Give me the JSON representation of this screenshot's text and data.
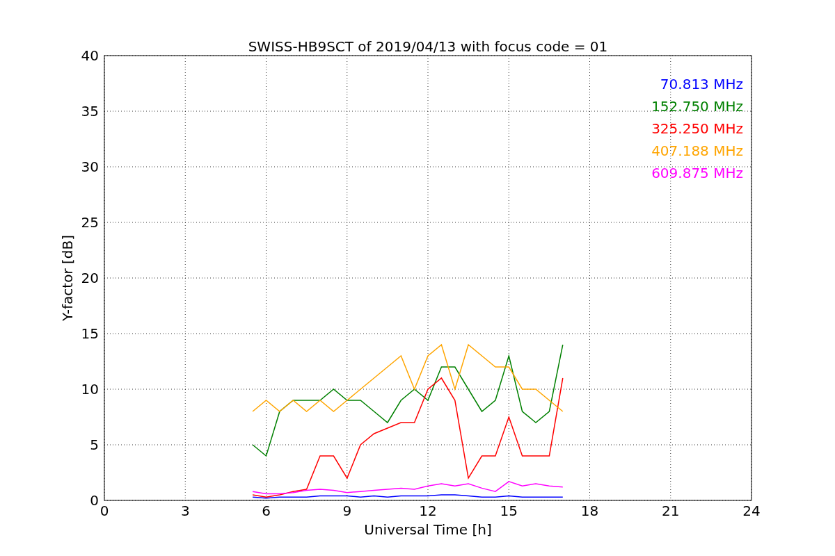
{
  "chart_data": {
    "type": "line",
    "title": "SWISS-HB9SCT of 2019/04/13 with focus code = 01",
    "xlabel": "Universal Time [h]",
    "ylabel": "Y-factor [dB]",
    "x": [
      5.5,
      6,
      6.5,
      7,
      7.5,
      8,
      8.5,
      9,
      9.5,
      10,
      10.5,
      11,
      11.5,
      12,
      12.5,
      13,
      13.5,
      14,
      14.5,
      15,
      15.5,
      16,
      16.5,
      17
    ],
    "series": [
      {
        "name": "70.813 MHz",
        "color": "#0000ff",
        "values": [
          0.3,
          0.2,
          0.3,
          0.3,
          0.3,
          0.4,
          0.4,
          0.4,
          0.3,
          0.4,
          0.3,
          0.4,
          0.4,
          0.4,
          0.5,
          0.5,
          0.4,
          0.3,
          0.3,
          0.4,
          0.3,
          0.3,
          0.3,
          0.3
        ]
      },
      {
        "name": "152.750 MHz",
        "color": "#008000",
        "values": [
          5,
          4,
          8,
          9,
          9,
          9,
          10,
          9,
          9,
          8,
          7,
          9,
          10,
          9,
          12,
          12,
          10,
          8,
          9,
          13,
          8,
          7,
          8,
          14
        ]
      },
      {
        "name": "325.250 MHz",
        "color": "#ff0000",
        "values": [
          0.5,
          0.3,
          0.5,
          0.8,
          1,
          4,
          4,
          2,
          5,
          6,
          6.5,
          7,
          7,
          10,
          11,
          9,
          2,
          4,
          4,
          7.5,
          4,
          4,
          4,
          11
        ]
      },
      {
        "name": "407.188 MHz",
        "color": "#ffa500",
        "values": [
          8,
          9,
          8,
          9,
          8,
          9,
          8,
          9,
          10,
          11,
          12,
          13,
          10,
          13,
          14,
          10,
          14,
          13,
          12,
          12,
          10,
          10,
          9,
          8
        ]
      },
      {
        "name": "609.875 MHz",
        "color": "#ff00ff",
        "values": [
          0.8,
          0.6,
          0.6,
          0.7,
          0.9,
          1,
          0.9,
          0.7,
          0.8,
          0.9,
          1,
          1.1,
          1,
          1.3,
          1.5,
          1.3,
          1.5,
          1.1,
          0.8,
          1.7,
          1.3,
          1.5,
          1.3,
          1.2
        ]
      }
    ],
    "xlim": [
      0,
      24
    ],
    "ylim": [
      0,
      40
    ],
    "xticks": [
      0,
      3,
      6,
      9,
      12,
      15,
      18,
      21,
      24
    ],
    "yticks": [
      0,
      5,
      10,
      15,
      20,
      25,
      30,
      35,
      40
    ],
    "grid": true
  }
}
